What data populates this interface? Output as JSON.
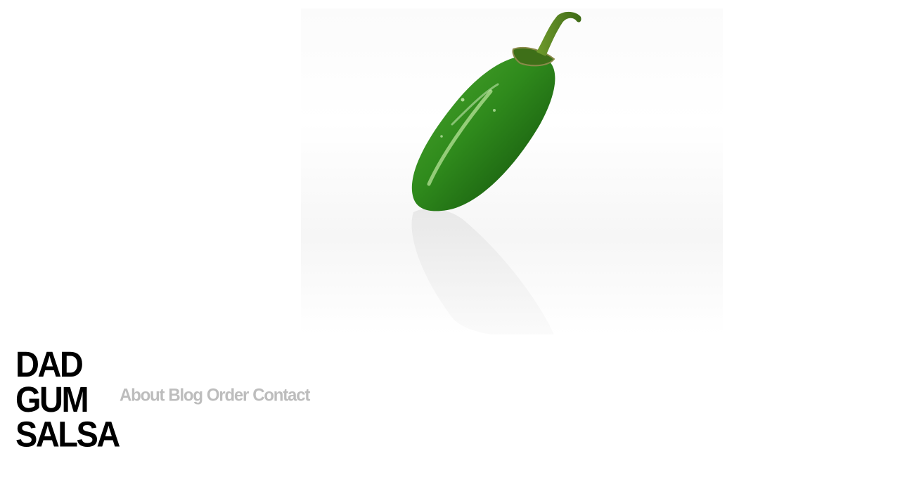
{
  "hero": {
    "image": "jalapeno-pepper-photo"
  },
  "logo": {
    "lines": [
      "DAD",
      "GUM",
      "SALSA"
    ]
  },
  "nav": {
    "items": [
      {
        "label": "About"
      },
      {
        "label": "Blog"
      },
      {
        "label": "Order"
      },
      {
        "label": "Contact"
      }
    ]
  },
  "colors": {
    "background": "#ffffff",
    "logo": "#000000",
    "nav_text": "#bdbdbd",
    "pepper_green": "#2f8f1e"
  }
}
